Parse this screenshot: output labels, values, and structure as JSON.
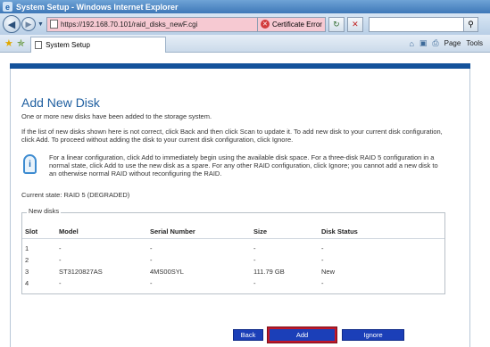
{
  "window": {
    "title": "System Setup - Windows Internet Explorer"
  },
  "address": {
    "url": "https://192.168.70.101/raid_disks_newF.cgi",
    "certificate_error": "Certificate Error"
  },
  "tab": {
    "label": "System Setup"
  },
  "toolbar": {
    "page_label": "Page",
    "tools_label": "Tools"
  },
  "page": {
    "title": "Add New Disk",
    "subtitle": "One or more new disks have been added to the storage system.",
    "instructions": "If the list of new disks shown here is not correct, click Back and then click Scan to update it. To add new disk to your current disk configuration, click Add. To proceed without adding the disk to your current disk configuration, click Ignore.",
    "note": "For a linear configuration, click Add to immediately begin using the available disk space. For a three-disk RAID 5 configuration in a normal state, click Add to use the new disk as a spare. For any other RAID configuration, click Ignore; you cannot add a new disk to an otherwise normal RAID without reconfiguring the RAID.",
    "current_state": "Current state: RAID 5 (DEGRADED)"
  },
  "new_disks": {
    "legend": "New disks",
    "columns": [
      "Slot",
      "Model",
      "Serial Number",
      "Size",
      "Disk Status"
    ],
    "rows": [
      [
        "1",
        "-",
        "-",
        "-",
        "-"
      ],
      [
        "2",
        "-",
        "-",
        "-",
        "-"
      ],
      [
        "3",
        "ST3120827AS",
        "4MS00SYL",
        "111.79 GB",
        "New"
      ],
      [
        "4",
        "-",
        "-",
        "-",
        "-"
      ]
    ]
  },
  "buttons": {
    "back": "Back",
    "add": "Add",
    "ignore": "Ignore"
  },
  "colors": {
    "accent": "#14529b",
    "button": "#1b3fb8",
    "focus": "#c0182a",
    "heading": "#1f5fa0"
  },
  "icons": [
    "ie-icon",
    "back-icon",
    "forward-icon",
    "certificate-error-icon",
    "refresh-icon",
    "stop-icon",
    "search-icon",
    "favorites-star-icon",
    "add-favorites-icon",
    "home-icon",
    "feeds-icon",
    "print-icon",
    "info-icon"
  ]
}
